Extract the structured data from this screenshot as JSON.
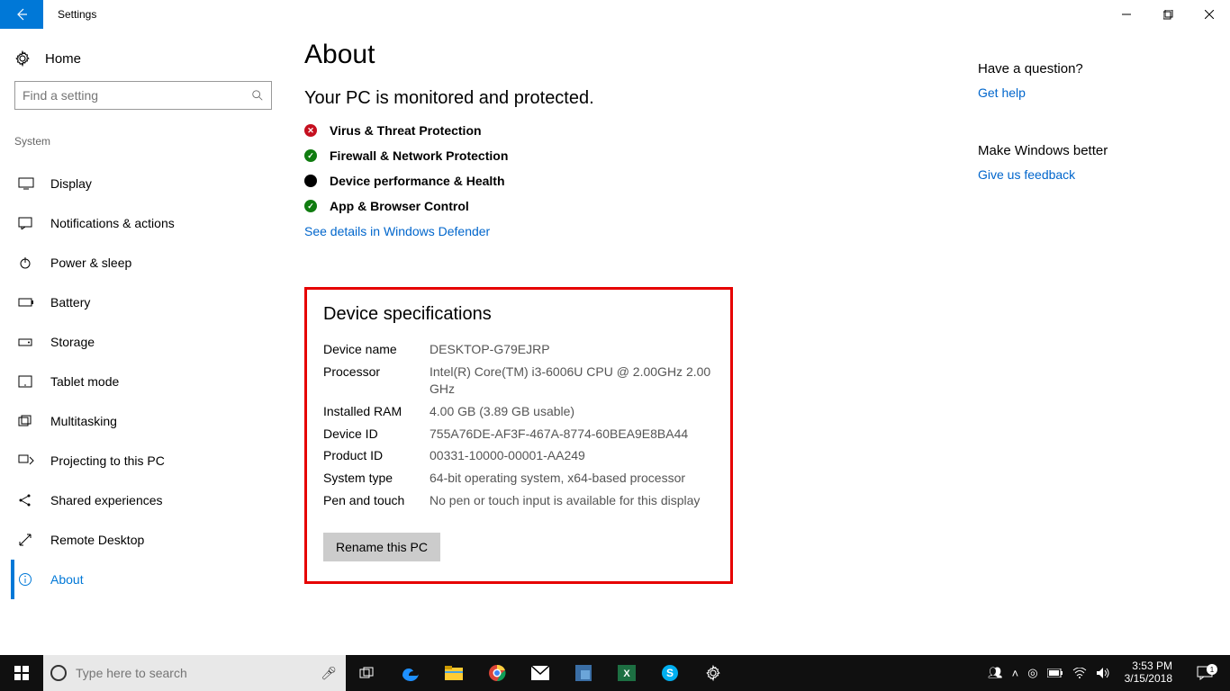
{
  "titlebar": {
    "title": "Settings"
  },
  "sidebar": {
    "home": "Home",
    "search_placeholder": "Find a setting",
    "category": "System",
    "items": [
      {
        "label": "Display"
      },
      {
        "label": "Notifications & actions"
      },
      {
        "label": "Power & sleep"
      },
      {
        "label": "Battery"
      },
      {
        "label": "Storage"
      },
      {
        "label": "Tablet mode"
      },
      {
        "label": "Multitasking"
      },
      {
        "label": "Projecting to this PC"
      },
      {
        "label": "Shared experiences"
      },
      {
        "label": "Remote Desktop"
      },
      {
        "label": "About"
      }
    ]
  },
  "page": {
    "title": "About",
    "subtitle": "Your PC is monitored and protected.",
    "protections": [
      {
        "status": "red",
        "label": "Virus & Threat Protection"
      },
      {
        "status": "green",
        "label": "Firewall & Network Protection"
      },
      {
        "status": "black",
        "label": "Device performance & Health"
      },
      {
        "status": "green",
        "label": "App & Browser Control"
      }
    ],
    "defender_link": "See details in Windows Defender",
    "device_spec_title": "Device specifications",
    "specs": {
      "device_name_k": "Device name",
      "device_name_v": "DESKTOP-G79EJRP",
      "processor_k": "Processor",
      "processor_v": "Intel(R) Core(TM) i3-6006U CPU @ 2.00GHz   2.00 GHz",
      "ram_k": "Installed RAM",
      "ram_v": "4.00 GB (3.89 GB usable)",
      "deviceid_k": "Device ID",
      "deviceid_v": "755A76DE-AF3F-467A-8774-60BEA9E8BA44",
      "productid_k": "Product ID",
      "productid_v": "00331-10000-00001-AA249",
      "systype_k": "System type",
      "systype_v": "64-bit operating system, x64-based processor",
      "pen_k": "Pen and touch",
      "pen_v": "No pen or touch input is available for this display"
    },
    "rename_btn": "Rename this PC"
  },
  "right": {
    "question_h": "Have a question?",
    "help_link": "Get help",
    "better_h": "Make Windows better",
    "feedback_link": "Give us feedback"
  },
  "taskbar": {
    "search_placeholder": "Type here to search",
    "time": "3:53 PM",
    "date": "3/15/2018",
    "notif_count": "1"
  }
}
